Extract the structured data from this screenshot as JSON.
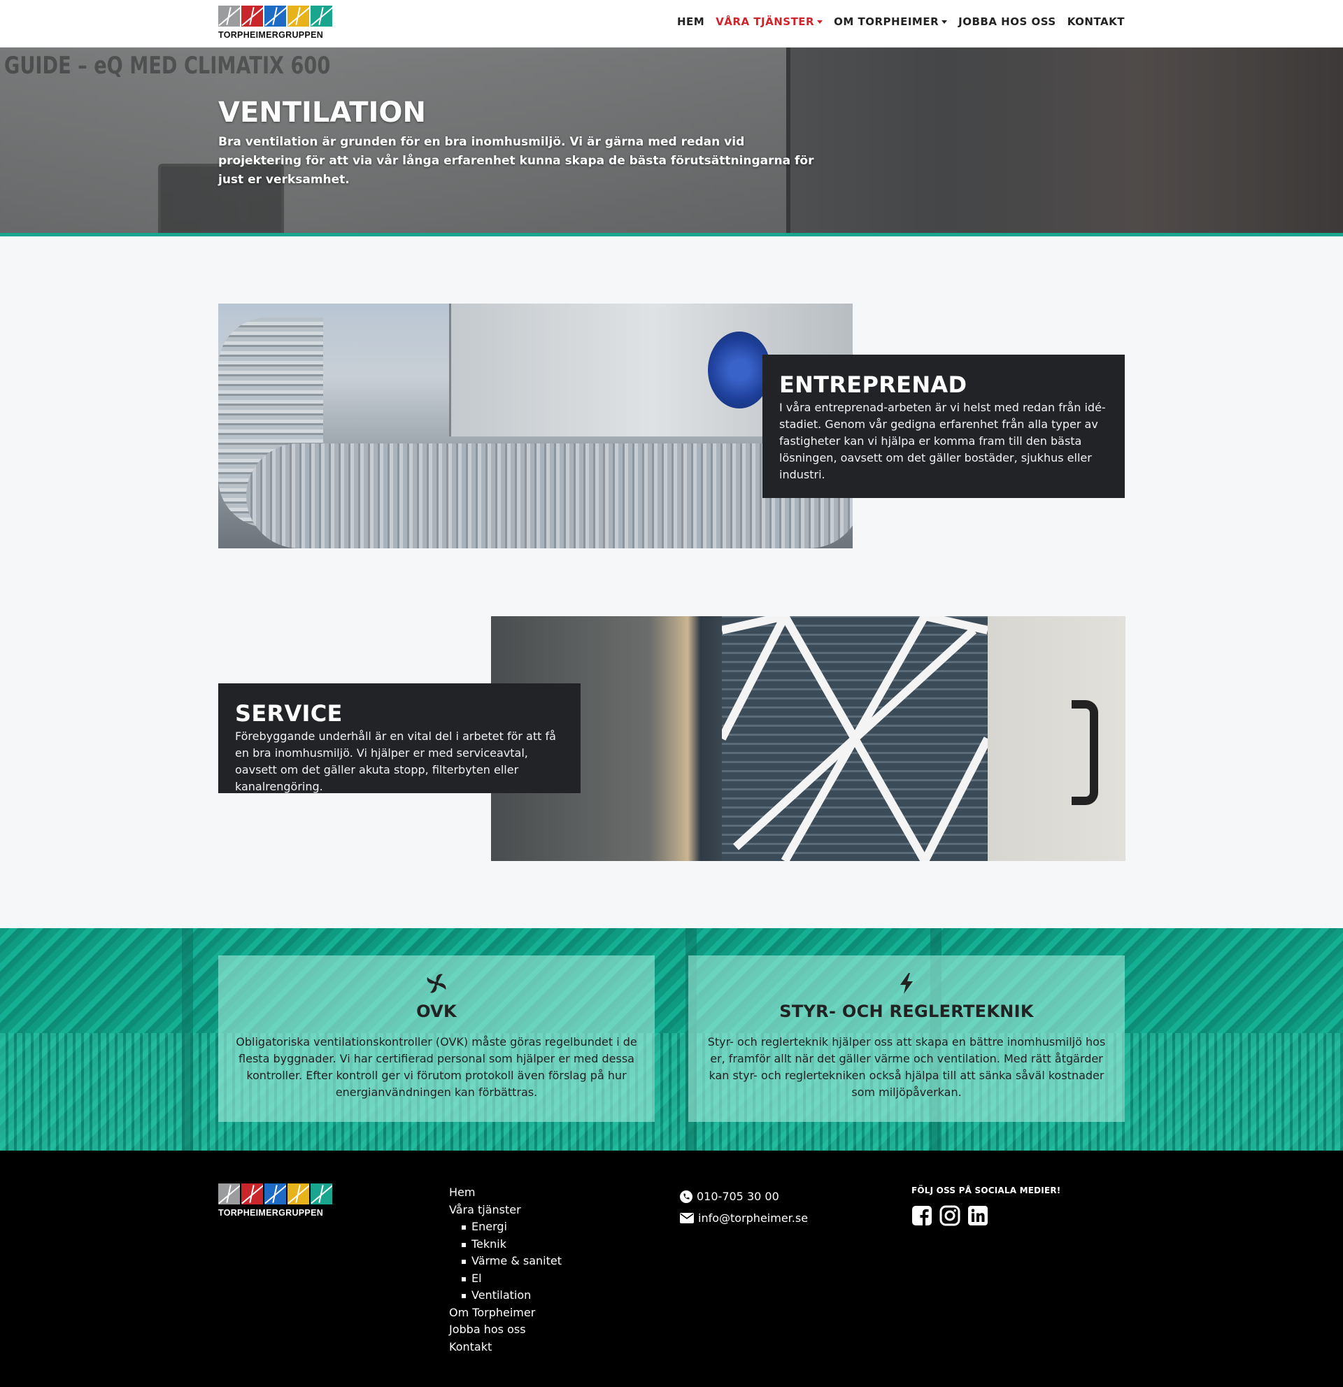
{
  "brand": {
    "name": "TORPHEIMERGRUPPEN",
    "tile_colors": [
      "#9a9c9e",
      "#c9262c",
      "#1e6bc6",
      "#e8b21b",
      "#1aa58f"
    ]
  },
  "nav": {
    "items": [
      {
        "label": "HEM",
        "active": false,
        "dropdown": false
      },
      {
        "label": "VÅRA TJÄNSTER",
        "active": true,
        "dropdown": true
      },
      {
        "label": "OM TORPHEIMER",
        "active": false,
        "dropdown": true
      },
      {
        "label": "JOBBA HOS OSS",
        "active": false,
        "dropdown": false
      },
      {
        "label": "KONTAKT",
        "active": false,
        "dropdown": false
      }
    ]
  },
  "hero": {
    "panel_text": "GUIDE – eQ MED CLIMATIX 600",
    "title": "VENTILATION",
    "text": "Bra ventilation är grunden för en bra inomhusmiljö. Vi är gärna med redan vid projektering för att via vår långa erfarenhet kunna skapa de bästa förutsättningarna för just er verksamhet."
  },
  "services": {
    "entreprenad": {
      "title": "ENTREPRENAD",
      "text": "I våra entreprenad-arbeten är vi helst med redan från idé-stadiet. Genom vår gedigna erfarenhet från alla typer av fastigheter kan vi hjälpa er komma fram till den bästa lösningen, oavsett om det gäller bostäder, sjukhus eller industri."
    },
    "service": {
      "title": "SERVICE",
      "text": "Förebyggande underhåll är en vital del i arbetet för att få en bra inomhusmiljö. Vi hjälper er med serviceavtal, oavsett om det gäller akuta stopp, filterbyten eller kanalrengöring."
    }
  },
  "info_boxes": {
    "ovk": {
      "icon": "fan-icon",
      "title": "OVK",
      "text": "Obligatoriska ventilationskontroller (OVK) måste göras regelbundet i de flesta byggnader. Vi har certifierad personal som hjälper er med dessa kontroller. Efter kontroll ger vi förutom protokoll även förslag på hur energianvändningen kan förbättras."
    },
    "styr": {
      "icon": "bolt-icon",
      "title": "STYR- OCH REGLERTEKNIK",
      "text": "Styr- och reglerteknik hjälper oss att skapa en bättre inomhusmiljö hos er, framför allt när det gäller värme och ventilation. Med rätt åtgärder kan styr- och reglertekniken också hjälpa till att sänka såväl kostnader som miljöpåverkan."
    }
  },
  "footer": {
    "nav": {
      "hem": "Hem",
      "tjanster": "Våra tjänster",
      "sub": [
        "Energi",
        "Teknik",
        "Värme & sanitet",
        "El",
        "Ventilation"
      ],
      "om": "Om Torpheimer",
      "jobba": "Jobba hos oss",
      "kontakt": "Kontakt"
    },
    "phone": "010-705 30 00",
    "email": "info@torpheimer.se",
    "social_heading": "FÖLJ OSS PÅ SOCIALA MEDIER!",
    "social": [
      "facebook-icon",
      "instagram-icon",
      "linkedin-icon"
    ]
  },
  "colors": {
    "accent_red": "#d2232a",
    "teal": "#1aa58f",
    "card_dark": "#212327",
    "footer_bg": "#000000"
  }
}
